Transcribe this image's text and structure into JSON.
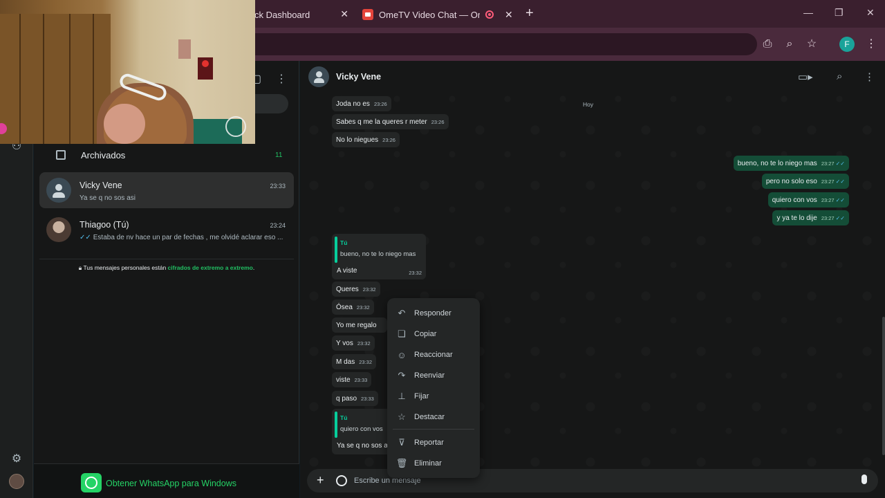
{
  "browser": {
    "tabs": [
      {
        "label": "ck Dashboard"
      },
      {
        "label": "OmeTV Video Chat — Ome"
      }
    ],
    "profile_initial": "F"
  },
  "sidebar": {
    "archived_label": "Archivados",
    "archived_count": "11",
    "chats": [
      {
        "name": "Vicky Vene",
        "time": "23:33",
        "preview": "Ya se q no sos asi"
      },
      {
        "name": "Thiagoo (Tú)",
        "time": "23:24",
        "preview": "Estaba de nv hace un par de fechas , me olvidé aclarar eso ..."
      }
    ],
    "encrypted_prefix": "Tus mensajes personales están ",
    "encrypted_link": "cifrados de extremo a extremo",
    "encrypted_suffix": ".",
    "get_app": "Obtener WhatsApp para Windows"
  },
  "conversation": {
    "title": "Vicky Vene",
    "day_label": "Hoy",
    "incoming_top": [
      {
        "text": "Joda no es",
        "time": "23:26"
      },
      {
        "text": "Sabes q me la queres r meter",
        "time": "23:26"
      },
      {
        "text": "No lo niegues",
        "time": "23:26"
      }
    ],
    "outgoing": [
      {
        "text": "bueno, no te lo niego mas",
        "time": "23:27"
      },
      {
        "text": "pero no solo eso",
        "time": "23:27"
      },
      {
        "text": "quiero con vos",
        "time": "23:27"
      },
      {
        "text": "y ya te lo dije",
        "time": "23:27"
      }
    ],
    "quote1": {
      "who": "Tú",
      "text": "bueno, no te lo niego mas",
      "reply": "A viste",
      "time": "23:32"
    },
    "incoming_bottom": [
      {
        "text": "Queres",
        "time": "23:32"
      },
      {
        "text": "Ósea",
        "time": "23:32"
      },
      {
        "text": "Yo me regalo",
        "time": ""
      },
      {
        "text": "Y vos",
        "time": "23:32"
      },
      {
        "text": "M das",
        "time": "23:32"
      },
      {
        "text": "viste",
        "time": "23:33"
      },
      {
        "text": "q paso",
        "time": "23:33"
      }
    ],
    "quote2": {
      "who": "Tú",
      "text": "quiero con vos",
      "reply": "Ya se q no sos a"
    },
    "composer_placeholder": "Escribe un mensaje"
  },
  "context_menu": {
    "items": [
      {
        "label": "Responder",
        "icon": "reply-icon"
      },
      {
        "label": "Copiar",
        "icon": "copy-icon"
      },
      {
        "label": "Reaccionar",
        "icon": "emoji-icon"
      },
      {
        "label": "Reenviar",
        "icon": "forward-icon"
      },
      {
        "label": "Fijar",
        "icon": "pin-icon"
      },
      {
        "label": "Destacar",
        "icon": "star-icon"
      },
      {
        "label": "Reportar",
        "icon": "thumbs-down-icon"
      },
      {
        "label": "Eliminar",
        "icon": "trash-icon"
      }
    ]
  }
}
